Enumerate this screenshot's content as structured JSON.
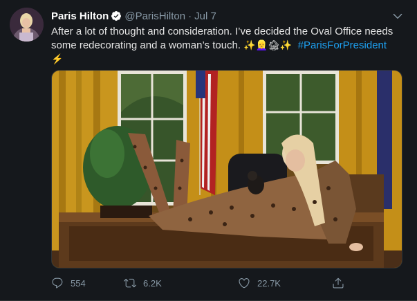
{
  "tweet": {
    "author_name": "Paris Hilton",
    "handle": "@ParisHilton",
    "separator": "·",
    "date": "Jul 7",
    "text_part1": "After a lot of thought and consideration. I’ve decided the Oval Office needs some redecorating and a woman’s touch. ",
    "emoji_sparkles": "✨",
    "emoji_blonde": "👱‍♀️",
    "emoji_house": "🏚",
    "emoji_sparkles2": "✨",
    "hashtag": "#ParisForPresident",
    "emoji_bolt": "⚡",
    "icons": {
      "verified": "verified-badge-icon",
      "menu": "chevron-down-icon",
      "reply": "reply-icon",
      "retweet": "retweet-icon",
      "like": "heart-icon",
      "share": "share-icon"
    }
  },
  "actions": {
    "reply_count": "554",
    "retweet_count": "6.2K",
    "like_count": "22.7K"
  },
  "colors": {
    "background": "#15181c",
    "accent": "#1da1f2",
    "muted": "#8899a6"
  }
}
